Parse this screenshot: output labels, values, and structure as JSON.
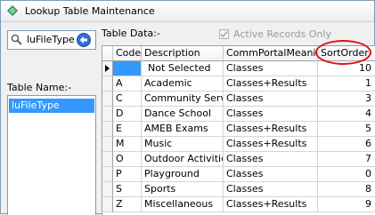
{
  "window": {
    "title": "Lookup Table Maintenance"
  },
  "search": {
    "value": "luFileType"
  },
  "left": {
    "table_name_label": "Table Name:-",
    "tables": [
      "luFileType"
    ]
  },
  "right": {
    "table_data_label": "Table Data:-",
    "active_only_label": "Active Records Only",
    "active_only_checked": true
  },
  "grid": {
    "columns": [
      "Code",
      "Description",
      "CommPortalMeaning",
      "SortOrder"
    ],
    "rows": [
      {
        "code": "",
        "description": "Not Selected",
        "meaning": "Classes",
        "sort": "10"
      },
      {
        "code": "A",
        "description": "Academic",
        "meaning": "Classes+Results",
        "sort": "1"
      },
      {
        "code": "C",
        "description": "Community Service",
        "meaning": "Classes",
        "sort": "3"
      },
      {
        "code": "D",
        "description": "Dance School",
        "meaning": "Classes",
        "sort": "4"
      },
      {
        "code": "E",
        "description": "AMEB Exams",
        "meaning": "Classes+Results",
        "sort": "5"
      },
      {
        "code": "M",
        "description": "Music",
        "meaning": "Classes+Results",
        "sort": "6"
      },
      {
        "code": "O",
        "description": "Outdoor Activities",
        "meaning": "Classes",
        "sort": "7"
      },
      {
        "code": "P",
        "description": "Playground",
        "meaning": "Classes",
        "sort": "0"
      },
      {
        "code": "S",
        "description": "Sports",
        "meaning": "Classes",
        "sort": "8"
      },
      {
        "code": "Z",
        "description": "Miscellaneous",
        "meaning": "Classes+Results",
        "sort": "9"
      }
    ]
  },
  "colors": {
    "selection": "#3399ff",
    "highlight_oval": "#e01010"
  }
}
